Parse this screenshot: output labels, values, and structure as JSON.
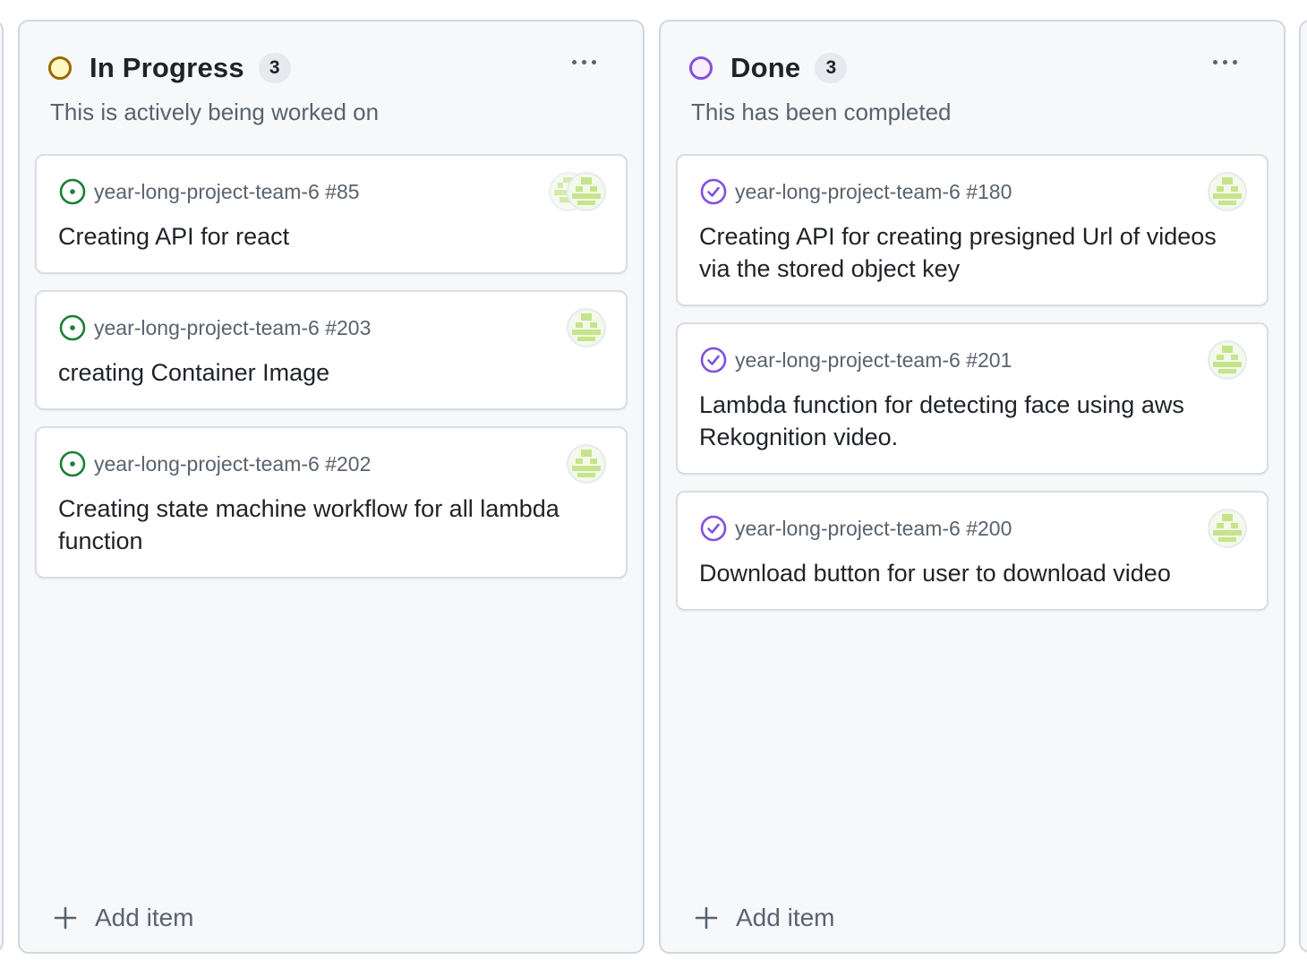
{
  "columns": [
    {
      "title": "In Progress",
      "count": "3",
      "description": "This is actively being worked on",
      "status_icon": "progress-circle-icon",
      "add_label": "Add item",
      "cards": [
        {
          "repo": "year-long-project-team-6 #85",
          "title": "Creating API for react",
          "issue_state": "open"
        },
        {
          "repo": "year-long-project-team-6 #203",
          "title": "creating Container Image",
          "issue_state": "open"
        },
        {
          "repo": "year-long-project-team-6 #202",
          "title": "Creating state machine workflow for all lambda function",
          "issue_state": "open"
        }
      ]
    },
    {
      "title": "Done",
      "count": "3",
      "description": "This has been completed",
      "status_icon": "done-circle-icon",
      "add_label": "Add item",
      "cards": [
        {
          "repo": "year-long-project-team-6 #180",
          "title": "Creating API for creating presigned Url of videos via the stored object key",
          "issue_state": "closed"
        },
        {
          "repo": "year-long-project-team-6 #201",
          "title": "Lambda function for detecting face using aws Rekognition video.",
          "issue_state": "closed"
        },
        {
          "repo": "year-long-project-team-6 #200",
          "title": "Download button for user to download video",
          "issue_state": "closed"
        }
      ]
    }
  ],
  "colors": {
    "open_issue": "#1a7f37",
    "closed_issue": "#8250df",
    "progress_status": "#9a6700",
    "done_status": "#8250df",
    "avatar_green": "#c6e48b"
  }
}
